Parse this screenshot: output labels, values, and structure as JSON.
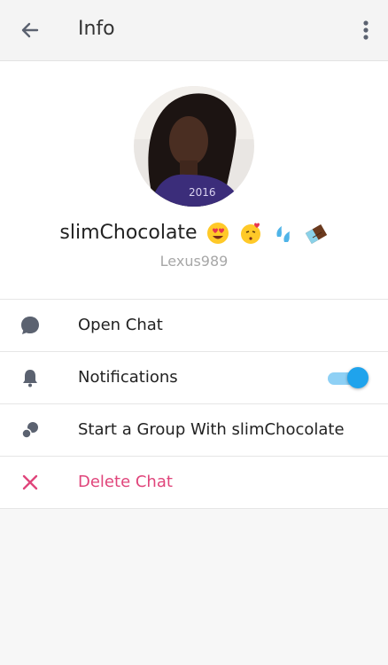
{
  "header": {
    "title": "Info"
  },
  "profile": {
    "display_name": "slimChocolate",
    "username": "Lexus989",
    "emojis": [
      "heart-eyes-emoji",
      "kissing-heart-emoji",
      "sweat-droplets-emoji",
      "chocolate-bar-emoji"
    ]
  },
  "actions": [
    {
      "label": "Open Chat",
      "icon": "chat-bubble-icon"
    },
    {
      "label": "Notifications",
      "icon": "bell-icon",
      "toggle_on": true
    },
    {
      "label": "Start a Group With slimChocolate",
      "icon": "group-icon"
    },
    {
      "label": "Delete Chat",
      "icon": "close-icon"
    }
  ],
  "colors": {
    "accent": "#1fa3ec",
    "danger": "#e0457b",
    "icon": "#5b6270"
  }
}
